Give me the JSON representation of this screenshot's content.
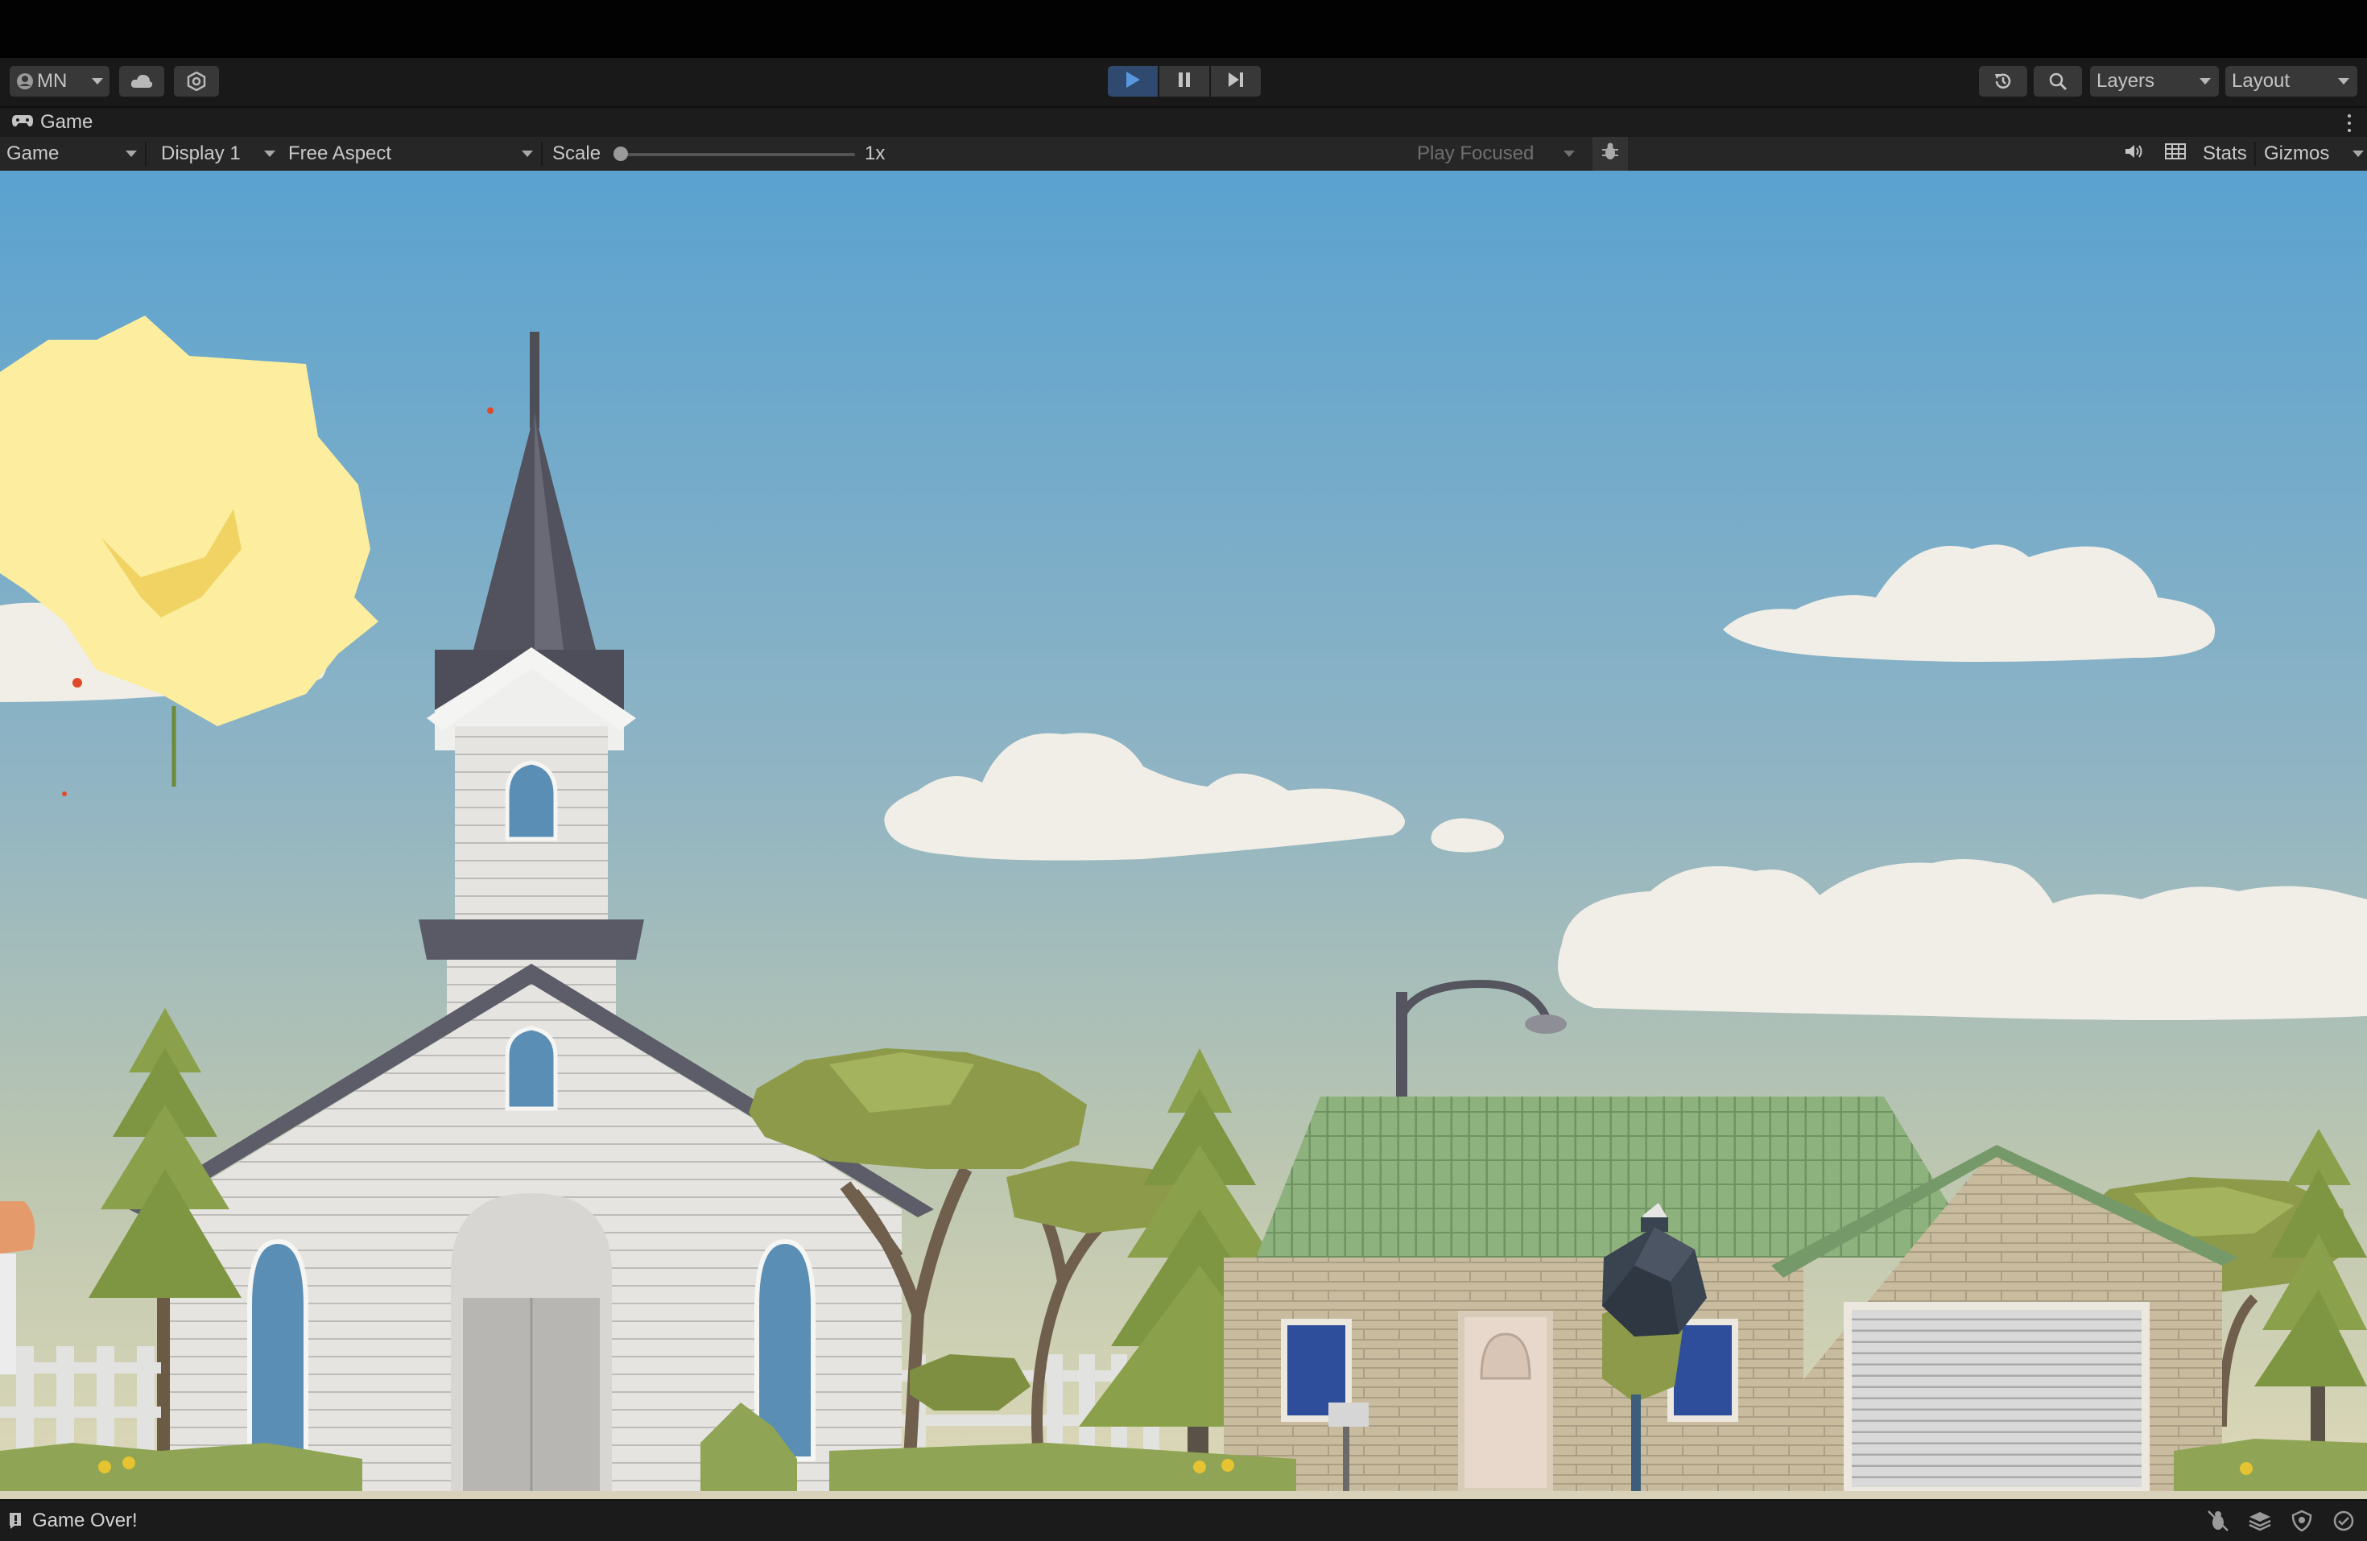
{
  "toolbar": {
    "account_label": "MN",
    "layers_label": "Layers",
    "layout_label": "Layout",
    "play_active": true,
    "accent_color": "#2f4a6e"
  },
  "tab": {
    "title": "Game",
    "icon": "gamepad-icon"
  },
  "gamebar": {
    "view_mode": "Game",
    "display": "Display 1",
    "aspect": "Free Aspect",
    "scale_label": "Scale",
    "scale_value": "1x",
    "scale_fraction": 0.0,
    "play_mode": "Play Focused",
    "stats_label": "Stats",
    "gizmos_label": "Gizmos"
  },
  "status": {
    "message": "Game Over!"
  },
  "icons": [
    "account-icon",
    "cloud-icon",
    "services-icon",
    "play-icon",
    "pause-icon",
    "step-icon",
    "history-icon",
    "search-icon",
    "gamepad-icon",
    "bug-icon",
    "audio-icon",
    "grid-icon",
    "status-info-icon"
  ],
  "scene": {
    "sky_top": "#5aa2d0",
    "sky_bottom": "#d9d7b7",
    "sun_color": "#fcee9e",
    "bomb_color": "#3a4350",
    "roof_green": "#8ab07a",
    "tree_green": "#8c9a4a"
  }
}
